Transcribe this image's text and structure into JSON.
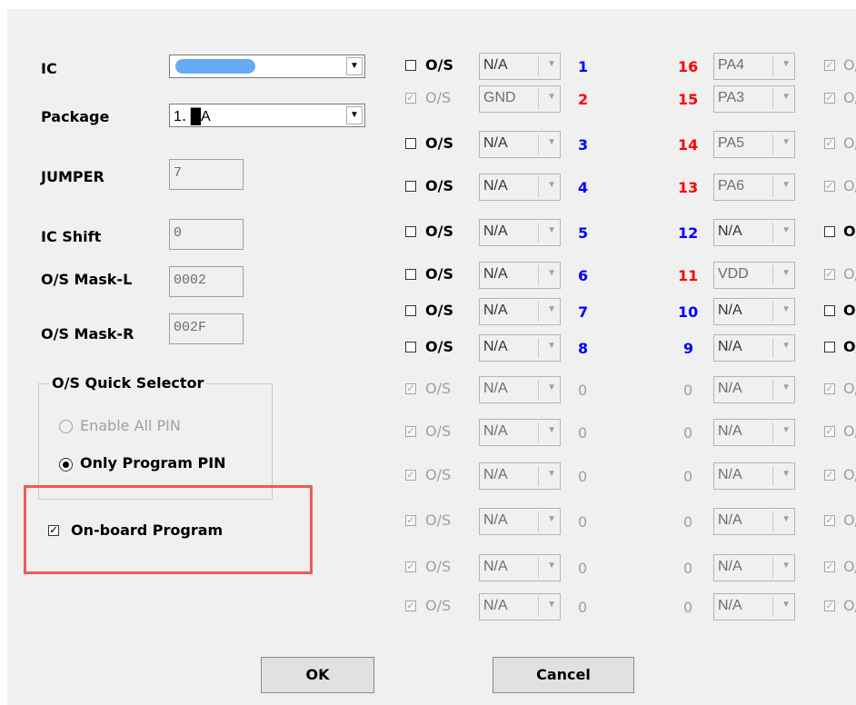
{
  "left": {
    "ic_label": "IC",
    "ic_value": "",
    "package_label": "Package",
    "package_value": "1․ █A",
    "jumper_label": "JUMPER",
    "jumper_value": "7",
    "ic_shift_label": "IC Shift",
    "ic_shift_value": "0",
    "mask_l_label": "O/S Mask-L",
    "mask_l_value": "0002",
    "mask_r_label": "O/S Mask-R",
    "mask_r_value": "002F",
    "selector_title": "O/S Quick Selector",
    "radio_enable_all": "Enable All PIN",
    "radio_only_program": "Only Program PIN",
    "onboard_label": "On-board Program",
    "onboard_checked": "✓"
  },
  "os_text": "O/S",
  "left_pins": [
    {
      "sel": "N/A",
      "num": "1",
      "color": "#0000ff",
      "checked": "",
      "enabled": true
    },
    {
      "sel": "GND",
      "num": "2",
      "color": "#ff0000",
      "checked": "✓",
      "enabled": false
    },
    {
      "sel": "N/A",
      "num": "3",
      "color": "#0000ff",
      "checked": "",
      "enabled": true
    },
    {
      "sel": "N/A",
      "num": "4",
      "color": "#0000ff",
      "checked": "",
      "enabled": true
    },
    {
      "sel": "N/A",
      "num": "5",
      "color": "#0000ff",
      "checked": "",
      "enabled": true
    },
    {
      "sel": "N/A",
      "num": "6",
      "color": "#0000ff",
      "checked": "",
      "enabled": true
    },
    {
      "sel": "N/A",
      "num": "7",
      "color": "#0000ff",
      "checked": "",
      "enabled": true
    },
    {
      "sel": "N/A",
      "num": "8",
      "color": "#0000ff",
      "checked": "",
      "enabled": true
    },
    {
      "sel": "N/A",
      "num": "0",
      "color": "#a0a0a0",
      "checked": "✓",
      "enabled": false
    },
    {
      "sel": "N/A",
      "num": "0",
      "color": "#a0a0a0",
      "checked": "✓",
      "enabled": false
    },
    {
      "sel": "N/A",
      "num": "0",
      "color": "#a0a0a0",
      "checked": "✓",
      "enabled": false
    },
    {
      "sel": "N/A",
      "num": "0",
      "color": "#a0a0a0",
      "checked": "✓",
      "enabled": false
    },
    {
      "sel": "N/A",
      "num": "0",
      "color": "#a0a0a0",
      "checked": "✓",
      "enabled": false
    },
    {
      "sel": "N/A",
      "num": "0",
      "color": "#a0a0a0",
      "checked": "✓",
      "enabled": false
    }
  ],
  "right_pins": [
    {
      "sel": "PA4",
      "num": "16",
      "color": "#ff0000",
      "checked": "✓",
      "enabled": false
    },
    {
      "sel": "PA3",
      "num": "15",
      "color": "#ff0000",
      "checked": "✓",
      "enabled": false
    },
    {
      "sel": "PA5",
      "num": "14",
      "color": "#ff0000",
      "checked": "✓",
      "enabled": false
    },
    {
      "sel": "PA6",
      "num": "13",
      "color": "#ff0000",
      "checked": "✓",
      "enabled": false
    },
    {
      "sel": "N/A",
      "num": "12",
      "color": "#0000ff",
      "checked": "",
      "enabled": true
    },
    {
      "sel": "VDD",
      "num": "11",
      "color": "#ff0000",
      "checked": "✓",
      "enabled": false
    },
    {
      "sel": "N/A",
      "num": "10",
      "color": "#0000ff",
      "checked": "",
      "enabled": true
    },
    {
      "sel": "N/A",
      "num": "9",
      "color": "#0000ff",
      "checked": "",
      "enabled": true
    },
    {
      "sel": "N/A",
      "num": "0",
      "color": "#a0a0a0",
      "checked": "✓",
      "enabled": false
    },
    {
      "sel": "N/A",
      "num": "0",
      "color": "#a0a0a0",
      "checked": "✓",
      "enabled": false
    },
    {
      "sel": "N/A",
      "num": "0",
      "color": "#a0a0a0",
      "checked": "✓",
      "enabled": false
    },
    {
      "sel": "N/A",
      "num": "0",
      "color": "#a0a0a0",
      "checked": "✓",
      "enabled": false
    },
    {
      "sel": "N/A",
      "num": "0",
      "color": "#a0a0a0",
      "checked": "✓",
      "enabled": false
    },
    {
      "sel": "N/A",
      "num": "0",
      "color": "#a0a0a0",
      "checked": "✓",
      "enabled": false
    }
  ],
  "buttons": {
    "ok": "OK",
    "cancel": "Cancel"
  },
  "colors": {
    "highlight_box": "#f05a5a",
    "blur": "#4a9cf5"
  }
}
